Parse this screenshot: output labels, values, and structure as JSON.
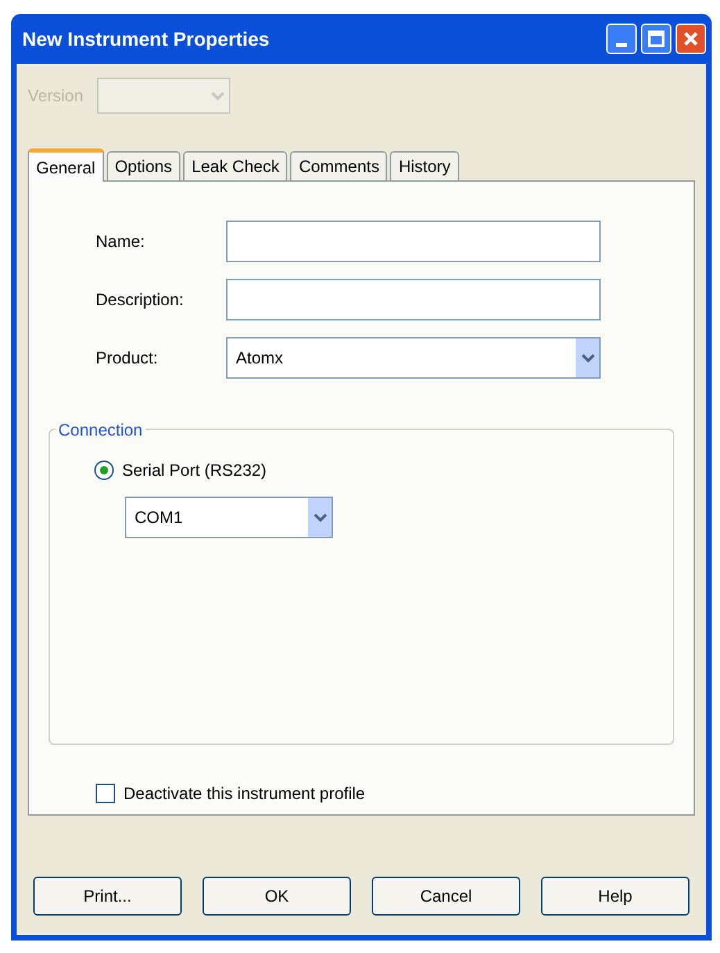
{
  "window": {
    "title": "New Instrument Properties"
  },
  "version": {
    "label": "Version",
    "disabled": true
  },
  "tabs": [
    {
      "label": "General",
      "selected": true
    },
    {
      "label": "Options",
      "selected": false
    },
    {
      "label": "Leak Check",
      "selected": false
    },
    {
      "label": "Comments",
      "selected": false
    },
    {
      "label": "History",
      "selected": false
    }
  ],
  "fields": [
    {
      "kind": "text",
      "label": "Name:"
    },
    {
      "kind": "text",
      "label": "Description:"
    },
    {
      "kind": "select",
      "label": "Product:",
      "value": "Atomx"
    }
  ],
  "connection": {
    "title": "Connection",
    "options": [
      {
        "label": "Serial Port (RS232)",
        "selected": true
      }
    ],
    "port": "COM1"
  },
  "deactivate": {
    "label": "Deactivate this instrument profile",
    "checked": false
  },
  "buttons": [
    "Print...",
    "OK",
    "Cancel",
    "Help"
  ]
}
